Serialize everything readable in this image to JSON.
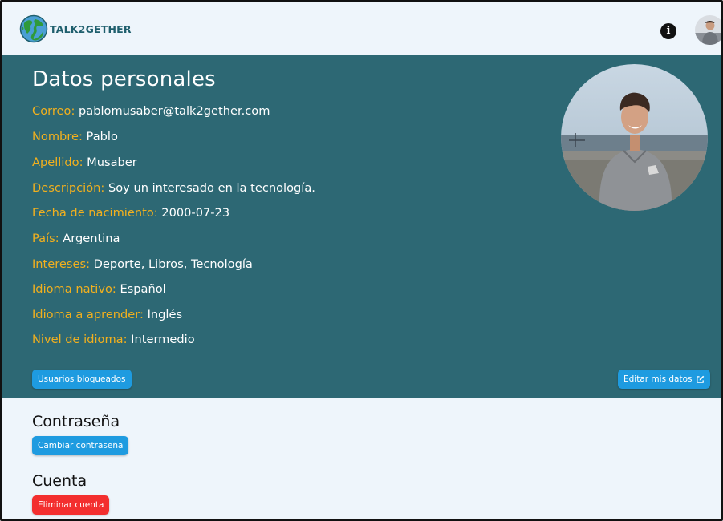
{
  "navbar": {
    "brand_text": "TALK2GETHER",
    "info_icon": "info-circle-icon",
    "info_glyph": "i"
  },
  "personal": {
    "title": "Datos personales",
    "fields": [
      {
        "label": "Correo:",
        "value": " pablomusaber@talk2gether.com"
      },
      {
        "label": "Nombre:",
        "value": " Pablo"
      },
      {
        "label": "Apellido:",
        "value": " Musaber"
      },
      {
        "label": "Descripción:",
        "value": " Soy un interesado en la tecnología."
      },
      {
        "label": "Fecha de nacimiento:",
        "value": " 2000-07-23"
      },
      {
        "label": "País:",
        "value": " Argentina"
      },
      {
        "label": "Intereses:",
        "value": " Deporte, Libros, Tecnología"
      },
      {
        "label": "Idioma nativo:",
        "value": " Español"
      },
      {
        "label": "Idioma a aprender:",
        "value": " Inglés"
      },
      {
        "label": "Nivel de idioma:",
        "value": " Intermedio"
      }
    ],
    "blocked_users_label": "Usuarios bloqueados",
    "edit_label": "Editar mis datos",
    "edit_icon": "edit-square-icon"
  },
  "password": {
    "title": "Contraseña",
    "change_label": "Cambiar contraseña"
  },
  "account": {
    "title": "Cuenta",
    "delete_label": "Eliminar cuenta"
  },
  "colors": {
    "panel_bg": "#2d6874",
    "label_yellow": "#f2b01e",
    "button_blue": "#1e9be0",
    "button_red": "#f32f2f",
    "page_bg": "#eef5fb"
  }
}
